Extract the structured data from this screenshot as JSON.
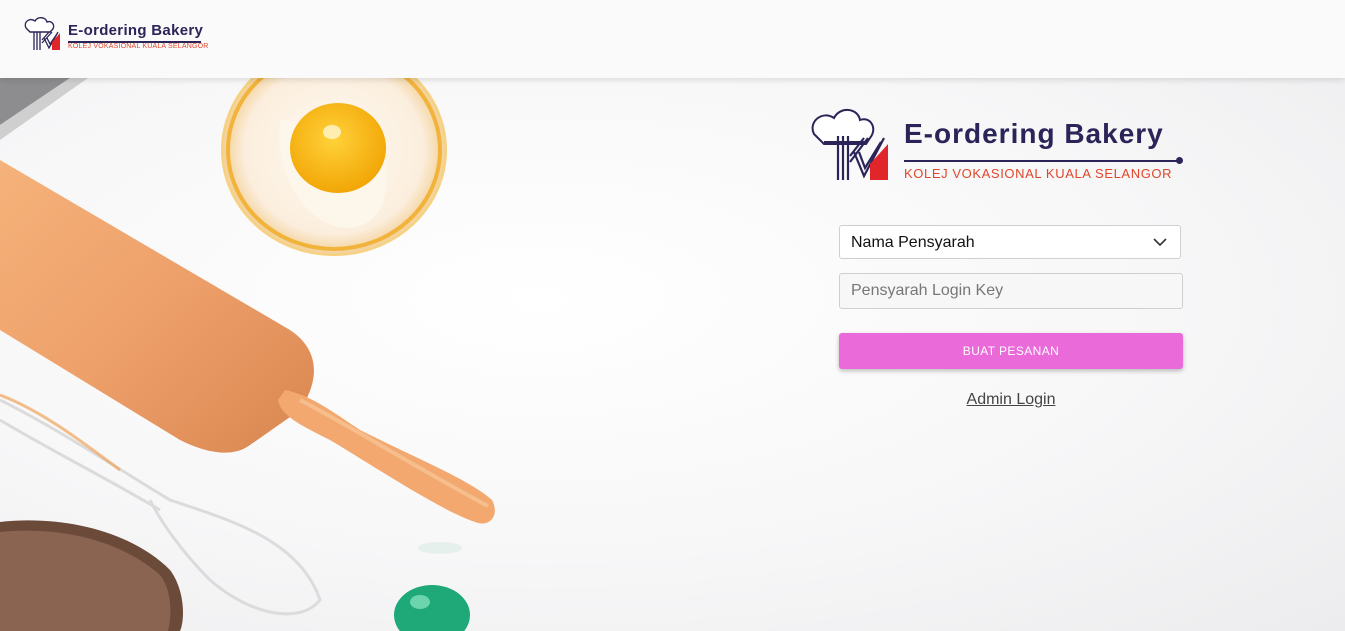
{
  "header": {
    "brand_title": "E-ordering Bakery",
    "brand_subtitle": "KOLEJ VOKASIONAL KUALA SELANGOR"
  },
  "panel": {
    "brand_title": "E-ordering Bakery",
    "brand_subtitle": "KOLEJ VOKASIONAL KUALA SELANGOR",
    "lecturer_select": {
      "selected": "Nama Pensyarah"
    },
    "login_key": {
      "placeholder": "Pensyarah Login Key",
      "value": ""
    },
    "order_button_label": "BUAT PESANAN",
    "admin_link_label": "Admin Login"
  },
  "colors": {
    "brand_navy": "#2b2458",
    "brand_red": "#e0462b",
    "button_pink": "#ea6ad9"
  },
  "icons": [
    "chef-hat-kv-logo-icon",
    "chevron-down-icon"
  ]
}
